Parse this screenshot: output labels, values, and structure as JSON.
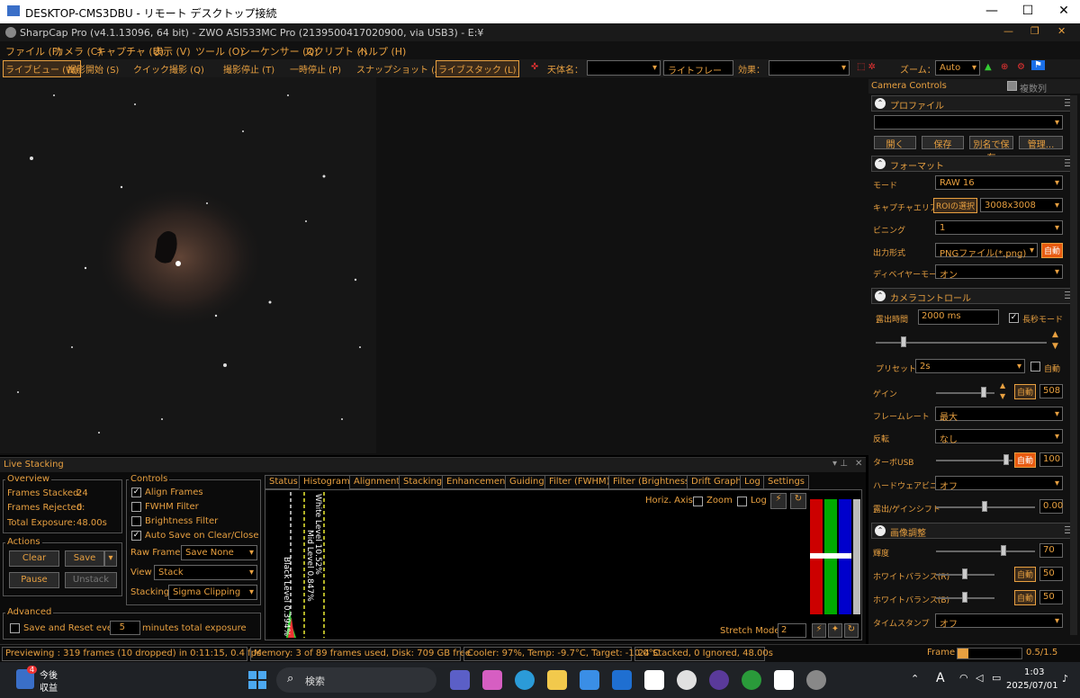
{
  "rdp": {
    "title": "DESKTOP-CMS3DBU - リモート デスクトップ接続",
    "min": "—",
    "max": "☐",
    "close": "✕"
  },
  "app": {
    "title": "SharpCap Pro (v4.1.13096, 64 bit) - ZWO ASI533MC Pro (2139500417020900, via USB3) - E:¥"
  },
  "menu": [
    "ファイル (F)",
    "カメラ (C)",
    "キャプチャ (U)",
    "表示 (V)",
    "ツール (O)",
    "シーケンサー (Q)",
    "スクリプト (I)",
    "ヘルプ (H)"
  ],
  "toolbar": {
    "live": "ライブビュー (W)",
    "start": "撮影開始 (S)",
    "quick": "クイック撮影 (Q)",
    "stop": "撮影停止 (T)",
    "pause": "一時停止 (P)",
    "snap": "スナップショット (A)",
    "stack": "ライブスタック (L)",
    "target_label": "天体名：",
    "frame": "ライトフレーム",
    "effect_label": "効果：",
    "zoom_label": "ズーム：",
    "zoom": "Auto"
  },
  "live": {
    "title": "Live Stacking",
    "overview": {
      "label": "Overview",
      "stacked_label": "Frames Stacked:",
      "stacked": "24",
      "rejected_label": "Frames Rejected:",
      "rejected": "0",
      "exposure_label": "Total Exposure:",
      "exposure": "48.00s"
    },
    "actions": {
      "label": "Actions",
      "clear": "Clear",
      "save": "Save",
      "pause": "Pause",
      "unstack": "Unstack"
    },
    "advanced": {
      "label": "Advanced",
      "save_reset": "Save and Reset every",
      "minutes": "5",
      "minutes_label": "minutes total exposure"
    },
    "controls": {
      "label": "Controls",
      "align": "Align Frames",
      "fwhm": "FWHM Filter",
      "brightness": "Brightness Filter",
      "autosave": "Auto Save on Clear/Close",
      "raw_label": "Raw Frames",
      "raw": "Save None",
      "view_label": "View",
      "view": "Stack",
      "stacking_label": "Stacking",
      "stacking": "Sigma Clipping"
    },
    "tabs": [
      "Status",
      "Histogram",
      "Alignment",
      "Stacking",
      "Enhancement",
      "Guiding",
      "Filter (FWHM)",
      "Filter (Brightness)",
      "Drift Graph",
      "Log",
      "Settings"
    ],
    "histogram": {
      "horiz": "Horiz. Axis:",
      "zoom": "Zoom",
      "log": "Log",
      "white": "White Level 10.52%",
      "mid": "Mid Level 0.847%",
      "black": "Black Level 0.394%",
      "stretch": "Stretch Mode",
      "stretch_val": "2"
    }
  },
  "cc": {
    "title": "Camera Controls",
    "multi": "複数列",
    "profile": {
      "title": "プロファイル",
      "open": "開く",
      "save": "保存",
      "saveas": "別名で保存",
      "manage": "管理..."
    },
    "format": {
      "title": "フォーマット",
      "mode_l": "モード",
      "mode": "RAW 16",
      "area_l": "キャプチャエリア",
      "roi": "ROIの選択",
      "area": "3008x3008",
      "bin_l": "ビニング",
      "bin": "1",
      "out_l": "出力形式",
      "out": "PNGファイル(*.png)",
      "auto": "自動",
      "debayer_l": "ディベイヤーモード",
      "debayer": "オン"
    },
    "camctl": {
      "title": "カメラコントロール",
      "exp_l": "露出時間",
      "exp": "2000 ms",
      "long": "長秒モード",
      "preset_l": "プリセット",
      "preset": "2s",
      "auto": "自動",
      "gain_l": "ゲイン",
      "gain": "508",
      "fr_l": "フレームレート",
      "fr": "最大",
      "flip_l": "反転",
      "flip": "なし",
      "turbo_l": "ターボUSB",
      "turbo": "100",
      "hdr_l": "ハードウェアビニング",
      "hdr": "オフ",
      "shift_l": "露出/ゲインシフト",
      "shift": "0.00"
    },
    "image": {
      "title": "画像調整",
      "bright_l": "輝度",
      "bright": "70",
      "wbr_l": "ホワイトバランス(R)",
      "wbr": "50",
      "wbb_l": "ホワイトバランス(B)",
      "wbb": "50",
      "ts_l": "タイムスタンプ",
      "ts": "オフ"
    }
  },
  "status": {
    "preview": "Previewing : 319 frames (10 dropped) in 0:11:15, 0.4 fps",
    "memory": "Memory: 3 of 89 frames used, Disk: 709 GB free",
    "cooler": "Cooler: 97%, Temp: -9.7°C, Target: -10.0°C",
    "stacked": "24 Stacked, 0 Ignored, 48.00s",
    "frame_l": "Frame :",
    "frame": "0.5/1.5"
  },
  "taskbar": {
    "weather": "今後",
    "weather2": "収益",
    "badge": "4",
    "search": "検索",
    "time": "1:03",
    "date": "2025/07/01",
    "ime": "A"
  }
}
